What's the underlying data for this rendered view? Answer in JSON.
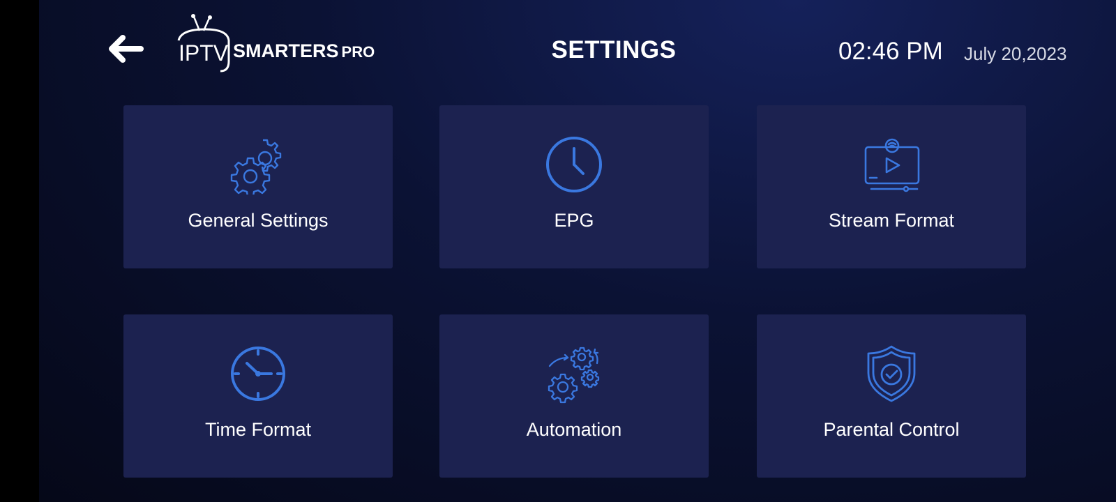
{
  "header": {
    "logo": {
      "tv_text": "IPTV",
      "brand_text": "SMARTERS",
      "pro_text": "PRO"
    },
    "title": "SETTINGS",
    "time": "02:46 PM",
    "date": "July 20,2023"
  },
  "colors": {
    "accent": "#3a78e0",
    "tile_bg": "#1c2250",
    "background": "#0b1234"
  },
  "tiles": [
    {
      "label": "General Settings",
      "icon": "gears-icon"
    },
    {
      "label": "EPG",
      "icon": "clock-icon"
    },
    {
      "label": "Stream Format",
      "icon": "stream-monitor-icon"
    },
    {
      "label": "Time Format",
      "icon": "time-clock-icon"
    },
    {
      "label": "Automation",
      "icon": "automation-gears-icon"
    },
    {
      "label": "Parental Control",
      "icon": "shield-check-icon"
    }
  ]
}
